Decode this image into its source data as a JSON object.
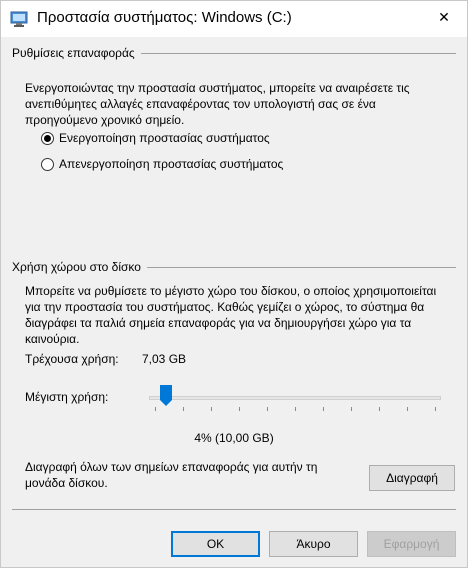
{
  "window": {
    "title": "Προστασία συστήματος: Windows (C:)",
    "close_glyph": "✕"
  },
  "restore_settings": {
    "header": "Ρυθμίσεις επαναφοράς",
    "description": "Ενεργοποιώντας την προστασία συστήματος, μπορείτε να αναιρέσετε τις ανεπιθύμητες αλλαγές επαναφέροντας τον υπολογιστή σας σε ένα προηγούμενο χρονικό σημείο.",
    "options": [
      {
        "label": "Ενεργοποίηση προστασίας συστήματος",
        "selected": true
      },
      {
        "label": "Απενεργοποίηση προστασίας συστήματος",
        "selected": false
      }
    ]
  },
  "disk_usage": {
    "header": "Χρήση χώρου στο δίσκο",
    "description": "Μπορείτε να ρυθμίσετε το μέγιστο χώρο του δίσκου, ο οποίος χρησιμοποιείται για την προστασία του συστήματος. Καθώς γεμίζει  ο χώρος, το σύστημα θα διαγράφει τα παλιά σημεία επαναφοράς για να δημιουργήσει χώρο για τα καινούρια.",
    "current_usage_label": "Τρέχουσα χρήση:",
    "current_usage_value": "7,03 GB",
    "max_usage_label": "Μέγιστη χρήση:",
    "max_usage_percent": 4,
    "max_usage_readout": "4% (10,00 GB)",
    "delete_description": "Διαγραφή όλων των σημείων επαναφοράς για αυτήν τη μονάδα δίσκου.",
    "delete_button": "Διαγραφή"
  },
  "footer": {
    "ok_button": "OK",
    "cancel_button": "Άκυρο",
    "apply_button": "Εφαρμογή"
  },
  "colors": {
    "accent": "#0078d7",
    "slider_thumb": "#0078d7"
  }
}
